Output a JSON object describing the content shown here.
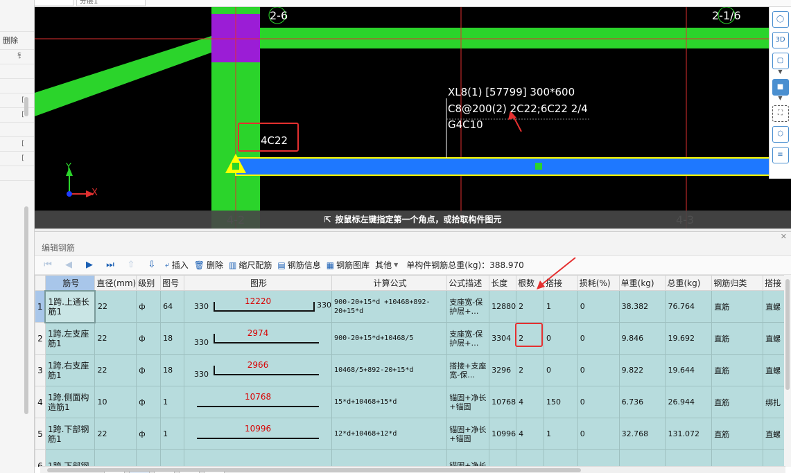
{
  "top_fields": {
    "left": "XL8(1)",
    "right": "分层1"
  },
  "left_panel": {
    "delete_label": "删除",
    "rows": [
      "",
      "",
      "钅",
      "",
      "",
      "[",
      "[",
      "",
      "[",
      "[",
      ""
    ]
  },
  "canvas": {
    "grid_labels": {
      "top_left": "2-6",
      "top_right": "2-1/6",
      "bottom_left": "4-2",
      "bottom_right": "4-3"
    },
    "beam_annotation": {
      "line1": "XL8(1) [57799] 300*600",
      "line2": "C8@200(2) 2C22;6C22 2/4",
      "line3": "G4C10"
    },
    "original_rebar": "4C22",
    "axis_y": "Y",
    "axis_x": "X",
    "status_text": "按鼠标左键指定第一个角点，或拾取构件图元",
    "colors": {
      "beam_green": "#2bd42b",
      "beam_blue": "#1e78ff",
      "column_purple": "#9b1dd6",
      "axis_red": "#e03030",
      "annotation_red": "#e53030"
    }
  },
  "right_toolbar": {
    "icons": [
      "sphere-icon",
      "3d-view-icon",
      "cube-outline-icon",
      "cube-solid-icon",
      "fullscreen-icon",
      "layer-cube-icon",
      "properties-icon"
    ],
    "labels": {
      "three_d": "3D"
    }
  },
  "editor": {
    "title": "编辑钢筋",
    "toolbar": {
      "insert": "插入",
      "delete": "删除",
      "scale_rebar": "缩尺配筋",
      "rebar_info": "钢筋信息",
      "rebar_library": "钢筋图库",
      "other": "其他",
      "total_weight": "单构件钢筋总重(kg)：388.970"
    },
    "columns": [
      "筋号",
      "直径(mm)",
      "级别",
      "图号",
      "图形",
      "计算公式",
      "公式描述",
      "长度",
      "根数",
      "搭接",
      "损耗(%)",
      "单重(kg)",
      "总重(kg)",
      "钢筋归类",
      "搭接"
    ],
    "rows": [
      {
        "no": "1",
        "name": "1跨.上通长筋1",
        "dia": "22",
        "grade": "ф",
        "fig": "64",
        "shape_left": "330",
        "shape_len": "12220",
        "shape_right": "330",
        "formula": "900-20+15*d +10468+892-20+15*d",
        "desc": "支座宽-保护层+…",
        "length": "12880",
        "count": "2",
        "lap": "1",
        "loss": "0",
        "unit_w": "38.382",
        "total_w": "76.764",
        "cat": "直筋",
        "lapt": "直螺"
      },
      {
        "no": "2",
        "name": "1跨.左支座筋1",
        "dia": "22",
        "grade": "ф",
        "fig": "18",
        "shape_left": "330",
        "shape_len": "2974",
        "shape_right": "",
        "formula": "900-20+15*d+10468/5",
        "desc": "支座宽-保护层+…",
        "length": "3304",
        "count": "2",
        "lap": "0",
        "loss": "0",
        "unit_w": "9.846",
        "total_w": "19.692",
        "cat": "直筋",
        "lapt": "直螺"
      },
      {
        "no": "3",
        "name": "1跨.右支座筋1",
        "dia": "22",
        "grade": "ф",
        "fig": "18",
        "shape_left": "330",
        "shape_len": "2966",
        "shape_right": "",
        "formula": "10468/5+892-20+15*d",
        "desc": "搭接+支座宽-保…",
        "length": "3296",
        "count": "2",
        "lap": "0",
        "loss": "0",
        "unit_w": "9.822",
        "total_w": "19.644",
        "cat": "直筋",
        "lapt": "直螺"
      },
      {
        "no": "4",
        "name": "1跨.侧面构造筋1",
        "dia": "10",
        "grade": "ф",
        "fig": "1",
        "shape_left": "",
        "shape_len": "10768",
        "shape_right": "",
        "formula": "15*d+10468+15*d",
        "desc": "锚固+净长+锚固",
        "length": "10768",
        "count": "4",
        "lap": "150",
        "loss": "0",
        "unit_w": "6.736",
        "total_w": "26.944",
        "cat": "直筋",
        "lapt": "绑扎"
      },
      {
        "no": "5",
        "name": "1跨.下部钢筋1",
        "dia": "22",
        "grade": "ф",
        "fig": "1",
        "shape_left": "",
        "shape_len": "10996",
        "shape_right": "",
        "formula": "12*d+10468+12*d",
        "desc": "锚固+净长+锚固",
        "length": "10996",
        "count": "4",
        "lap": "1",
        "loss": "0",
        "unit_w": "32.768",
        "total_w": "131.072",
        "cat": "直筋",
        "lapt": "直螺"
      },
      {
        "no": "6",
        "name": "1跨.下部钢",
        "dia": "",
        "grade": "",
        "fig": "",
        "shape_left": "",
        "shape_len": "",
        "shape_right": "",
        "formula": "",
        "desc": "锚固+净长",
        "length": "",
        "count": "",
        "lap": "",
        "loss": "",
        "unit_w": "",
        "total_w": "",
        "cat": "",
        "lapt": ""
      }
    ]
  }
}
